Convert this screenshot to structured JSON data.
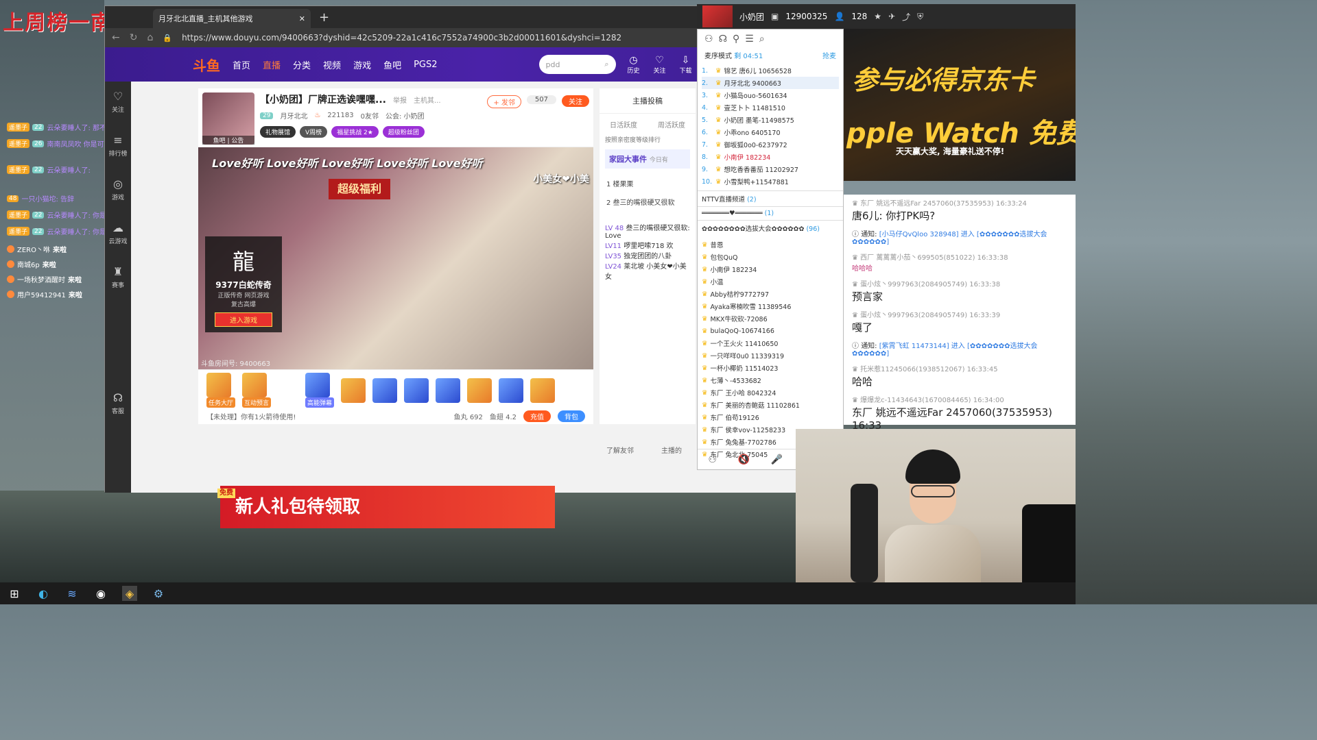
{
  "desktop": {
    "brand": "上周榜一南城",
    "danmaku": [
      {
        "badge": "遥墨子",
        "lv": "22",
        "text": "云朵要睡人了: 那不是?"
      },
      {
        "badge": "遥墨子",
        "lv": "26",
        "text": "南南凤凤吹 你是可以"
      },
      {
        "badge": "遥墨子",
        "lv": "22",
        "text": "云朵要睡人了:"
      },
      {
        "badge": "48",
        "lv": "",
        "text": "一只小猫坨: 告辞"
      },
      {
        "badge": "遥墨子",
        "lv": "22",
        "text": "云朵要睡人了: 你是纯色懒"
      },
      {
        "badge": "遥墨子",
        "lv": "22",
        "text": "云朵要睡人了: 你是在说一半"
      }
    ],
    "joins": [
      {
        "user": "ZERO丶咻",
        "text": "来啦"
      },
      {
        "user": "南城6p",
        "text": "来啦"
      },
      {
        "user": "一场秋梦酒醒时",
        "text": "来啦"
      },
      {
        "user": "用户59412941",
        "text": "来啦"
      }
    ]
  },
  "browser": {
    "tab_title": "月牙北北直播_主机其他游戏",
    "url": "https://www.douyu.com/9400663?dyshid=42c5209-22a1c416c7552a74900c3b2d00011601&dyshci=1282"
  },
  "nav": {
    "logo": "斗鱼",
    "items": [
      "首页",
      "直播",
      "分类",
      "视频",
      "游戏",
      "鱼吧",
      "PGS2"
    ],
    "search_placeholder": "pdd",
    "tools": [
      "历史",
      "关注",
      "下载"
    ]
  },
  "rail": [
    "关注",
    "排行榜",
    "游戏",
    "云游戏",
    "赛事",
    "客服"
  ],
  "room": {
    "avatar_caption": "鱼吧 | 公告",
    "title": "【小奶团】厂牌正选诶嘿嘿...",
    "report": "举报",
    "category": "主机其...",
    "fan_btn": "+ 发邻",
    "fan_count": "507",
    "follow_btn": "关注",
    "level": "29",
    "streamer": "月牙北北",
    "hot": "221183",
    "friends": "0友邻",
    "guild": "公会: 小奶团",
    "tags": [
      "礼物展馆",
      "V周榜",
      "福星挑战 2★",
      "超级粉丝团"
    ],
    "banner": "Love好听 Love好听 Love好听 Love好听 Love好听",
    "video_caption": "小美女❤小美",
    "ribbon": "超级福利",
    "game_ad": {
      "big": "龍",
      "name": "9377白蛇传奇",
      "sub1": "正版传奇",
      "sub2": "网页游戏",
      "sub3": "复古高爆",
      "go": "进入游戏"
    },
    "room_no": "斗鱼房间号: 9400663",
    "gift_tools": [
      "任务大厅",
      "互动预言",
      "高能弹幕"
    ],
    "status": "【未处理】你有1火箭待使用!",
    "fishball": "鱼丸 692",
    "fishwing": "鱼翅 4.2",
    "charge": "充值",
    "bag": "背包"
  },
  "newbie": {
    "free": "免费",
    "text": "新人礼包待领取"
  },
  "rank": {
    "header": "主播投稿",
    "tabs": [
      "日活跃度",
      "周活跃度"
    ],
    "sub": "按照亲密度等级排行",
    "family": "家园大事件",
    "family_sub": "今日有",
    "items": [
      "楼果栗",
      "叁三的嘴很硬又很软"
    ],
    "chat": [
      {
        "who": "LV 48",
        "text": "叁三的嘴很硬又很软: Love"
      },
      {
        "who": "LV11",
        "text": "啰里吧嗦718 欢"
      },
      {
        "who": "LV35",
        "text": "独宠团团的八卦"
      },
      {
        "who": "LV24",
        "text": "莱北坡 小美女❤小美女"
      }
    ],
    "learn": "了解友邻",
    "anchor": "主播的"
  },
  "fan": {
    "mode": "麦序模式",
    "timer": "剩 04:51",
    "grab": "抢麦",
    "list": [
      {
        "no": "1.",
        "name": "锦艺 唐6儿 10656528"
      },
      {
        "no": "2.",
        "name": "月牙北北 9400663"
      },
      {
        "no": "3.",
        "name": "小猫岛ouo-5601634"
      },
      {
        "no": "4.",
        "name": "壹芝卜卜 11481510"
      },
      {
        "no": "5.",
        "name": "小奶团 墨笔-11498575"
      },
      {
        "no": "6.",
        "name": "小乖ono 6405170"
      },
      {
        "no": "7.",
        "name": "御坂狐0o0-6237972"
      },
      {
        "no": "8.",
        "name": "小南伊 182234"
      },
      {
        "no": "9.",
        "name": "想吃香香番茄 11202927"
      },
      {
        "no": "10.",
        "name": "小雪梨鸭+11547881"
      }
    ],
    "sections": [
      {
        "name": "NTTV直播频道",
        "count": "(2)"
      },
      {
        "name": "═══════♥═══════",
        "count": "(1)"
      },
      {
        "name": "✿✿✿✿✿✿✿✿选拔大会✿✿✿✿✿✿",
        "count": "(96)"
      }
    ],
    "members": [
      "昔恩",
      "包包QuQ",
      "小南伊 182234",
      "小温",
      "Abby桔柠9772797",
      "Ayaka寒楠吹雪 11389546",
      "MKX牛砍砍-72086",
      "bulaQoQ-10674166",
      "一个王火火 11410650",
      "一只咩咩0u0 11339319",
      "一杯小椰奶 11514023",
      "七薄丶-4533682",
      "东厂 王小哈 8042324",
      "东厂 美丽的杏鲍菇 11102861",
      "东厂 伯苟19126",
      "东厂 侯幸vov-11258233",
      "东厂 兔兔基-7702786",
      "东厂 兔北北 75045"
    ]
  },
  "streambar": {
    "name": "小奶团",
    "room": "12900325",
    "count": "128"
  },
  "ad": {
    "line1": "参与必得京东卡",
    "line2": "pple Watch 免费",
    "line3": "天天赢大奖, 海量豪礼送不停!"
  },
  "chat": [
    {
      "type": "msg",
      "meta": "东厂 姚远不遥远Far 2457060(37535953) 16:33:24",
      "text": "唐6儿: 你打PK吗?"
    },
    {
      "type": "notice",
      "meta": "通知:",
      "text": "[小马仔QvQloo 328948] 进入 [✿✿✿✿✿✿✿选拔大会✿✿✿✿✿✿]"
    },
    {
      "type": "msg",
      "meta": "西厂 蓠蓠蓠小茄丶699505(851022) 16:33:38",
      "text": "哈哈哈",
      "red": true
    },
    {
      "type": "msg",
      "meta": "蛋小炫丶9997963(2084905749) 16:33:38",
      "text": "预言家"
    },
    {
      "type": "msg",
      "meta": "蛋小炫丶9997963(2084905749) 16:33:39",
      "text": "嘎了"
    },
    {
      "type": "notice",
      "meta": "通知:",
      "text": "[紫霄飞虹 11473144] 进入 [✿✿✿✿✿✿✿选拔大会✿✿✿✿✿✿]"
    },
    {
      "type": "msg",
      "meta": "托米惹11245066(1938512067) 16:33:45",
      "text": "哈哈"
    },
    {
      "type": "msg",
      "meta": "爆爆龙c-11434643(1670084465) 16:34:00",
      "text": "东厂 姚远不遥远Far 2457060(37535953) 16:33"
    }
  ]
}
